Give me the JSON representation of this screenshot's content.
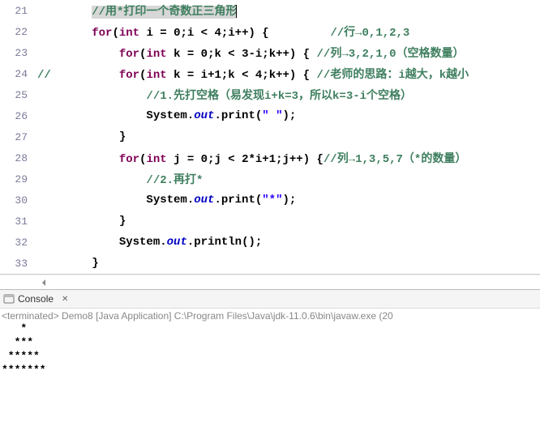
{
  "editor": {
    "lines": [
      {
        "num": "21",
        "tokens": [
          [
            "dflt",
            "        "
          ],
          [
            "cm",
            "//用*打印一个奇数正三角形"
          ]
        ],
        "highlight": true,
        "caret": true
      },
      {
        "num": "22",
        "tokens": [
          [
            "dflt",
            "        "
          ],
          [
            "kw",
            "for"
          ],
          [
            "dflt",
            "("
          ],
          [
            "kw",
            "int"
          ],
          [
            "dflt",
            " i = 0;i < 4;i++) {         "
          ],
          [
            "cm",
            "//行→0,1,2,3"
          ]
        ]
      },
      {
        "num": "23",
        "tokens": [
          [
            "dflt",
            "            "
          ],
          [
            "kw",
            "for"
          ],
          [
            "dflt",
            "("
          ],
          [
            "kw",
            "int"
          ],
          [
            "dflt",
            " k = 0;k < 3-i;k++) { "
          ],
          [
            "cm",
            "//列→3,2,1,0（空格数量）"
          ]
        ]
      },
      {
        "num": "24",
        "tokens": [
          [
            "cm",
            "//          "
          ],
          [
            "kw",
            "for"
          ],
          [
            "dflt",
            "("
          ],
          [
            "kw",
            "int"
          ],
          [
            "dflt",
            " k = i+1;k < 4;k++) { "
          ],
          [
            "cm",
            "//老师的思路：i越大，k越小"
          ]
        ]
      },
      {
        "num": "25",
        "tokens": [
          [
            "dflt",
            "                "
          ],
          [
            "cm",
            "//1.先打空格（易发现i+k=3，所以k=3-i个空格）"
          ]
        ]
      },
      {
        "num": "26",
        "tokens": [
          [
            "dflt",
            "                System."
          ],
          [
            "fld",
            "out"
          ],
          [
            "dflt",
            ".print("
          ],
          [
            "str",
            "\" \""
          ],
          [
            "dflt",
            ");"
          ]
        ]
      },
      {
        "num": "27",
        "tokens": [
          [
            "dflt",
            "            }"
          ]
        ]
      },
      {
        "num": "28",
        "tokens": [
          [
            "dflt",
            "            "
          ],
          [
            "kw",
            "for"
          ],
          [
            "dflt",
            "("
          ],
          [
            "kw",
            "int"
          ],
          [
            "dflt",
            " j = 0;j < 2*i+1;j++) {"
          ],
          [
            "cm",
            "//列→1,3,5,7（*的数量）"
          ]
        ]
      },
      {
        "num": "29",
        "tokens": [
          [
            "dflt",
            "                "
          ],
          [
            "cm",
            "//2.再打*"
          ]
        ]
      },
      {
        "num": "30",
        "tokens": [
          [
            "dflt",
            "                System."
          ],
          [
            "fld",
            "out"
          ],
          [
            "dflt",
            ".print("
          ],
          [
            "str",
            "\"*\""
          ],
          [
            "dflt",
            ");"
          ]
        ]
      },
      {
        "num": "31",
        "tokens": [
          [
            "dflt",
            "            }"
          ]
        ]
      },
      {
        "num": "32",
        "tokens": [
          [
            "dflt",
            "            System."
          ],
          [
            "fld",
            "out"
          ],
          [
            "dflt",
            ".println();"
          ]
        ]
      },
      {
        "num": "33",
        "tokens": [
          [
            "dflt",
            "        }"
          ]
        ]
      }
    ]
  },
  "console": {
    "title": "Console",
    "terminated_line": "<terminated> Demo8 [Java Application] C:\\Program Files\\Java\\jdk-11.0.6\\bin\\javaw.exe (20",
    "output": [
      "   *",
      "  ***",
      " *****",
      "*******"
    ]
  }
}
